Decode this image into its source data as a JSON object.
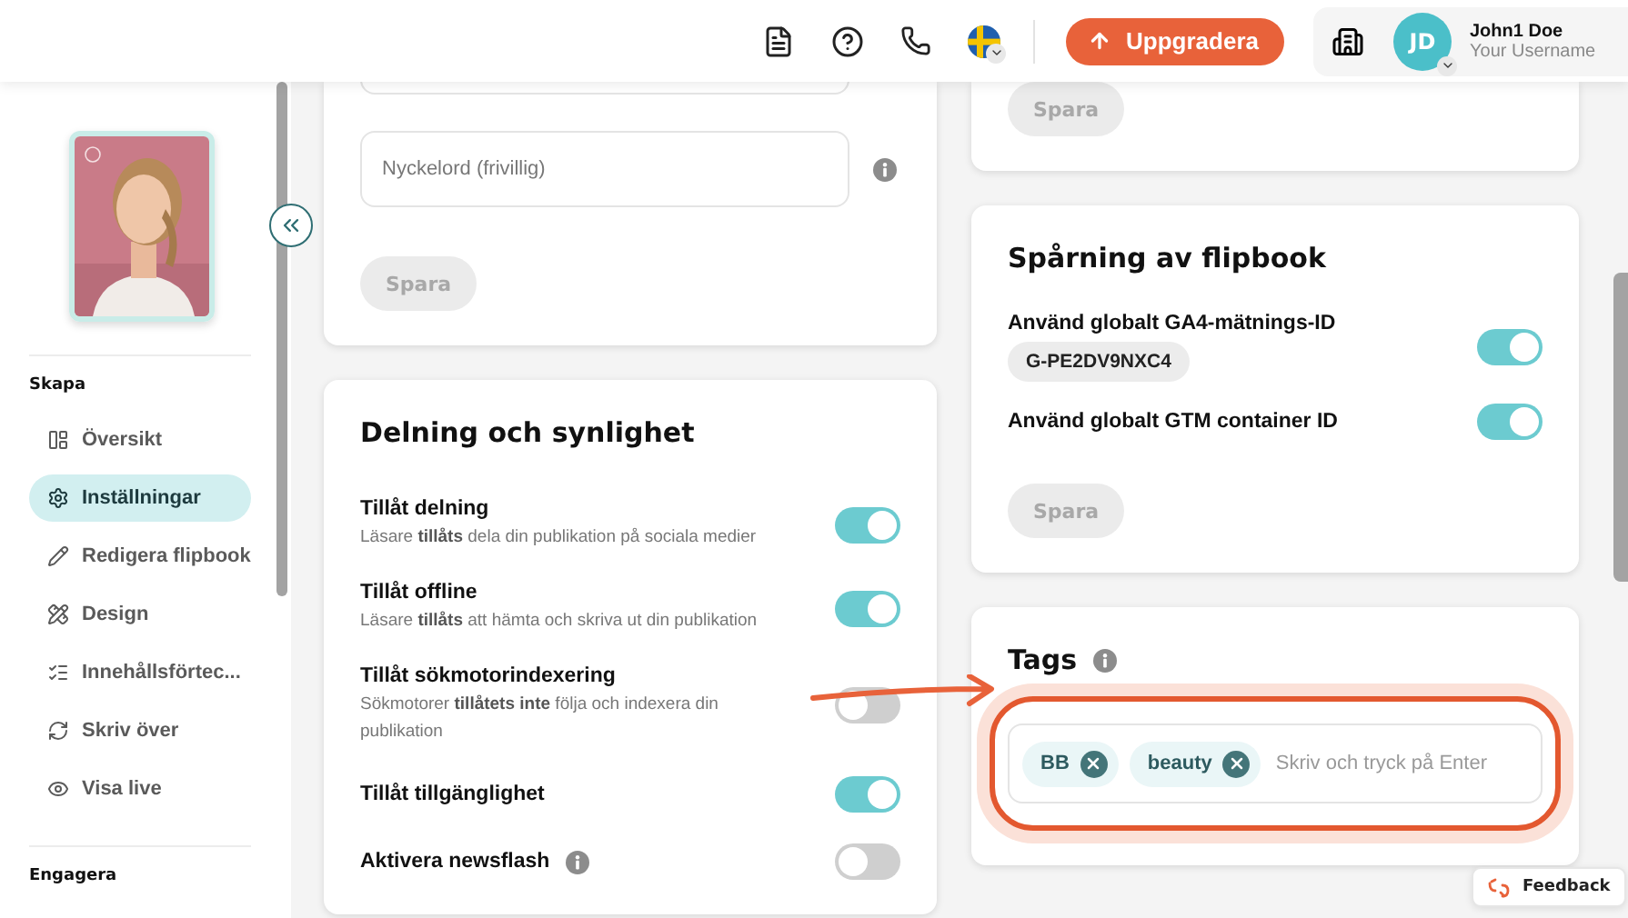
{
  "header": {
    "upgrade_button": "Uppgradera",
    "user": {
      "initials": "JD",
      "name": "John1 Doe",
      "username": "Your Username"
    }
  },
  "sidebar": {
    "sections": [
      {
        "title": "Skapa",
        "items": [
          {
            "label": "Översikt",
            "selected": false
          },
          {
            "label": "Inställningar",
            "selected": true
          },
          {
            "label": "Redigera flipbook",
            "selected": false
          },
          {
            "label": "Design",
            "selected": false
          },
          {
            "label": "Innehållsförtec...",
            "selected": false
          },
          {
            "label": "Skriv över",
            "selected": false
          },
          {
            "label": "Visa live",
            "selected": false
          }
        ]
      },
      {
        "title": "Engagera"
      }
    ]
  },
  "seo_card": {
    "keywords_field": {
      "placeholder": "Nyckelord (frivillig)"
    },
    "save_button": {
      "label": "Spara",
      "disabled": true
    }
  },
  "sharing_card": {
    "title": "Delning och synlighet",
    "settings": [
      {
        "label": "Tillåt delning",
        "description": "Läsare **tillåts** dela din publikation på sociala medier",
        "on": true,
        "info": false
      },
      {
        "label": "Tillåt offline",
        "description": "Läsare **tillåts** att hämta och skriva ut din publikation",
        "on": true,
        "info": false
      },
      {
        "label": "Tillåt sökmotorindexering",
        "description": "Sökmotorer **tillåtets inte** följa och indexera din publikation",
        "on": false,
        "info": false
      },
      {
        "label": "Tillåt tillgänglighet",
        "on": true,
        "info": false
      },
      {
        "label": "Aktivera newsflash",
        "on": false,
        "info": true
      }
    ]
  },
  "top_right_card": {
    "save_button": {
      "label": "Spara",
      "disabled": true
    }
  },
  "tracking_card": {
    "title": "Spårning av flipbook",
    "settings": [
      {
        "label": "Använd globalt GA4-mätnings-ID",
        "value": "G-PE2DV9NXC4",
        "on": true
      },
      {
        "label": "Använd globalt GTM container ID",
        "on": true
      }
    ],
    "save_button": {
      "label": "Spara",
      "disabled": true
    }
  },
  "tags_card": {
    "title": "Tags",
    "highlighted": true,
    "tags": [
      {
        "label": "BB"
      },
      {
        "label": "beauty"
      }
    ],
    "placeholder": "Skriv och tryck på Enter"
  },
  "feedback_button": "Feedback"
}
